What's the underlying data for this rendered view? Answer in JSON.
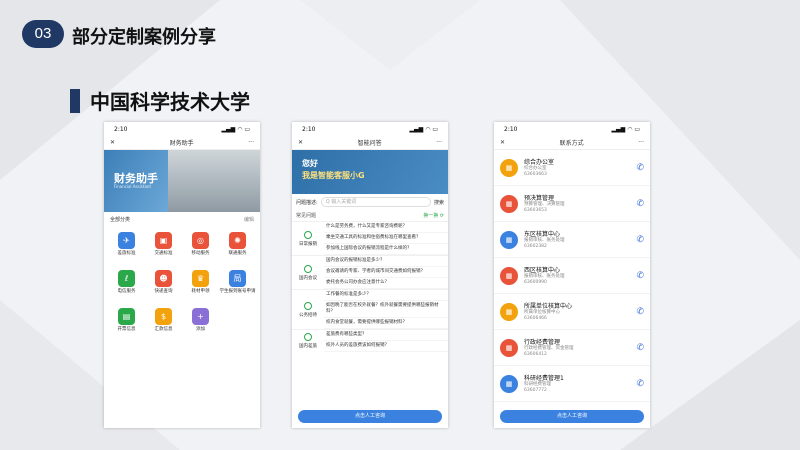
{
  "header": {
    "number": "03",
    "title": "部分定制案例分享"
  },
  "subheader": {
    "title": "中国科学技术大学"
  },
  "phone1": {
    "time": "2:10",
    "title": "财务助手",
    "close": "✕",
    "more": "···",
    "banner_title": "财务助手",
    "banner_sub": "Financial Assistant",
    "section": "全部分类",
    "edit": "编辑",
    "items": [
      {
        "label": "差旅标准",
        "color": "#3b82e0",
        "icon": "✈"
      },
      {
        "label": "交通标准",
        "color": "#e8533a",
        "icon": "▣"
      },
      {
        "label": "移动服务",
        "color": "#e8533a",
        "icon": "◎"
      },
      {
        "label": "联通服务",
        "color": "#e8533a",
        "icon": "✺"
      },
      {
        "label": "电信服务",
        "color": "#2ba84a",
        "icon": "ℓ"
      },
      {
        "label": "快递查询",
        "color": "#e8533a",
        "icon": "☻"
      },
      {
        "label": "耗材申领",
        "color": "#f2a20c",
        "icon": "♛"
      },
      {
        "label": "学生报到账号申请",
        "color": "#3b82e0",
        "icon": "局"
      },
      {
        "label": "开票信息",
        "color": "#2ba84a",
        "icon": "▤"
      },
      {
        "label": "汇款信息",
        "color": "#f2a20c",
        "icon": "$"
      },
      {
        "label": "添加",
        "color": "#8a6fd6",
        "icon": "+"
      }
    ]
  },
  "phone2": {
    "time": "2:10",
    "title": "智能问答",
    "close": "✕",
    "more": "···",
    "banner_l1": "您好",
    "banner_l2": "我是智能客服小G",
    "search_label": "问题描述:",
    "search_placeholder": "Q 输入关键词",
    "search_btn": "搜索",
    "faq": "常见问题",
    "refresh": "换一换 ⟳",
    "cats": [
      {
        "name": "日常报销",
        "qs": [
          "什么是劳务费，什么又是专家咨询费呢？",
          "乘坐交通工具的标准和住宿费标准在哪里查看？",
          "参加线上国际会议的报销流程是什么样的？"
        ]
      },
      {
        "name": "国内会议",
        "qs": [
          "国内会议的报销标准是多少？",
          "会议邀请的专家、学者的城市间交通费如何报销？",
          "委托会务公司办会应注意什么？"
        ]
      },
      {
        "name": "公务招待",
        "qs": [
          "工作餐的标准是多少？",
          "如因晚了能否在校外就餐？校外就餐需要提供哪些报销材料？",
          "校内食堂就餐，需要提供哪些报销材料？"
        ]
      },
      {
        "name": "国内差旅",
        "qs": [
          "差旅费有哪些类型？",
          "校外人员的差旅费该如何报销？"
        ]
      }
    ],
    "button": "点击人工咨询"
  },
  "phone3": {
    "time": "2:10",
    "title": "联系方式",
    "close": "✕",
    "more": "···",
    "contacts": [
      {
        "name": "综合办公室",
        "sub1": "综合办公室",
        "sub2": "63603663",
        "color": "#f2a20c"
      },
      {
        "name": "预决算管理",
        "sub1": "预算管理、决算管理",
        "sub2": "63603653",
        "color": "#e8533a"
      },
      {
        "name": "东区核算中心",
        "sub1": "报销审核、账务处理",
        "sub2": "63602382",
        "color": "#3b82e0"
      },
      {
        "name": "西区核算中心",
        "sub1": "报销审核、账务处理",
        "sub2": "63600990",
        "color": "#e8533a"
      },
      {
        "name": "所属单位核算中心",
        "sub1": "所属单位核算中心",
        "sub2": "63606466",
        "color": "#f2a20c"
      },
      {
        "name": "行政经费管理",
        "sub1": "行政经费管理、资金管理",
        "sub2": "63606412",
        "color": "#e8533a"
      },
      {
        "name": "科研经费管理1",
        "sub1": "科研经费管理",
        "sub2": "63607772",
        "color": "#3b82e0"
      }
    ],
    "button": "点击人工咨询"
  }
}
